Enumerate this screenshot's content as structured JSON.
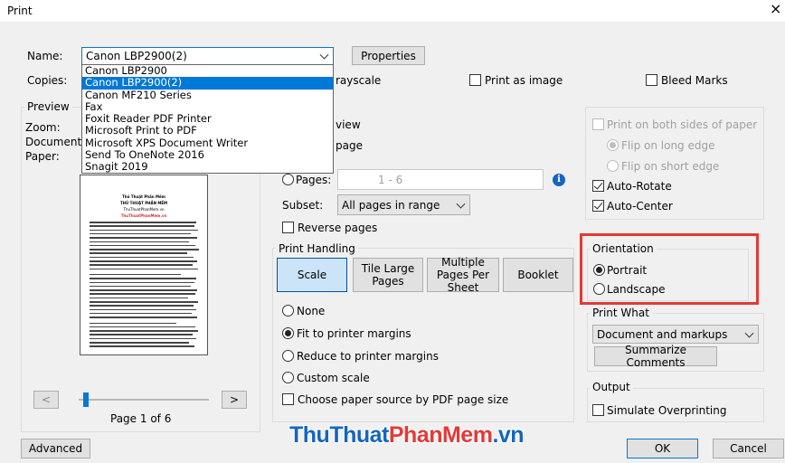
{
  "window": {
    "title": "Print",
    "close_glyph": "×"
  },
  "printer": {
    "name_label": "Name:",
    "selected": "Canon LBP2900(2)",
    "options": [
      "Canon LBP2900",
      "Canon LBP2900(2)",
      "Canon MF210 Series",
      "Fax",
      "Foxit Reader PDF Printer",
      "Microsoft Print to PDF",
      "Microsoft XPS Document Writer",
      "Send To OneNote 2016",
      "Snagit 2019"
    ],
    "properties_label": "Properties",
    "copies_label": "Copies:",
    "grayscale_label": "rayscale",
    "print_as_image_label": "Print as image",
    "bleed_marks_label": "Bleed Marks"
  },
  "preview": {
    "title": "Preview",
    "zoom_label": "Zoom:",
    "document_label": "Document:",
    "paper_label": "Paper:",
    "page_indicator": "Page 1 of 6",
    "prev_glyph": "<",
    "next_glyph": ">"
  },
  "pages": {
    "view_label": "view",
    "page_label": "page",
    "pages_radio_label": "Pages:",
    "pages_value": "1 - 6",
    "info_glyph": "i",
    "subset_label": "Subset:",
    "subset_value": "All pages in range",
    "reverse_label": "Reverse pages"
  },
  "print_handling": {
    "title": "Print Handling",
    "tabs": [
      "Scale",
      "Tile Large Pages",
      "Multiple Pages Per Sheet",
      "Booklet"
    ],
    "options": [
      "None",
      "Fit to printer margins",
      "Reduce to printer margins",
      "Custom scale"
    ],
    "selected_option": "Fit to printer margins",
    "paper_source_label": "Choose paper source by PDF page size"
  },
  "duplex": {
    "both_sides_label": "Print on both sides of paper",
    "long_edge_label": "Flip on long edge",
    "short_edge_label": "Flip on short edge",
    "auto_rotate_label": "Auto-Rotate",
    "auto_center_label": "Auto-Center"
  },
  "orientation": {
    "title": "Orientation",
    "portrait_label": "Portrait",
    "landscape_label": "Landscape",
    "highlight_color": "#e53935"
  },
  "print_what": {
    "title": "Print What",
    "value": "Document and markups",
    "summarize_label": "Summarize Comments"
  },
  "output": {
    "title": "Output",
    "simulate_label": "Simulate Overprinting"
  },
  "footer": {
    "advanced_label": "Advanced",
    "ok_label": "OK",
    "cancel_label": "Cancel"
  },
  "watermark": {
    "part1": "ThuThuat",
    "part2": "PhanMem",
    "part3": ".vn"
  },
  "thumbnail": {
    "line1": "Thủ Thuật Phần Mềm",
    "line2": "THỦ THUẬT PHẦN MỀM",
    "line3": "ThuThuatPhanMem.vn",
    "line4": "ThuThuatPhanMem.vn"
  },
  "colors": {
    "selection": "#0078d7",
    "info_icon": "#1565c0",
    "scale_tab_bg": "#cce4f7"
  }
}
